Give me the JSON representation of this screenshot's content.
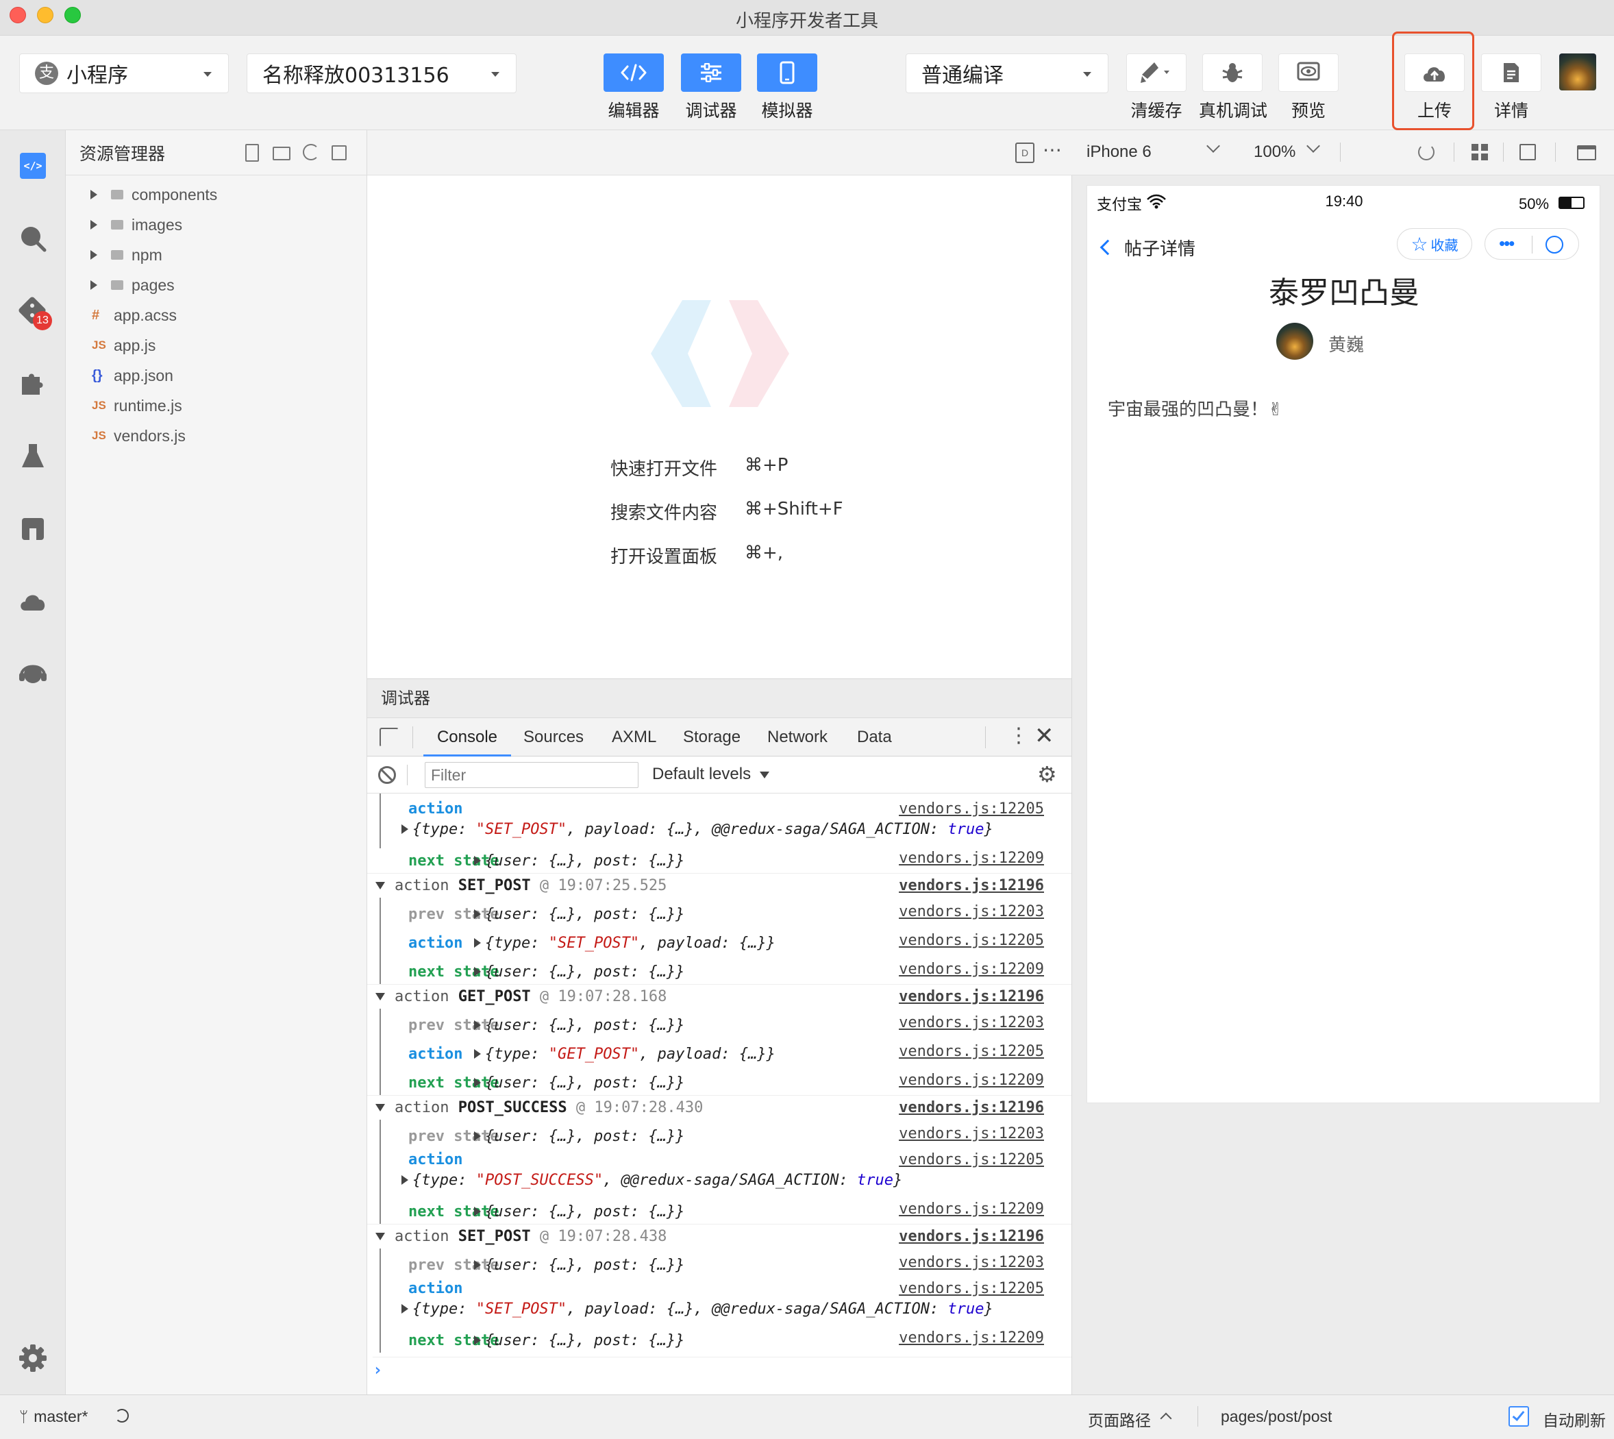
{
  "window": {
    "title": "小程序开发者工具"
  },
  "toolbar": {
    "app_type": "小程序",
    "project_name": "名称释放00313156",
    "compile_mode": "普通编译",
    "mode_buttons": [
      {
        "label": "编辑器",
        "icon": "code-icon"
      },
      {
        "label": "调试器",
        "icon": "sliders-icon"
      },
      {
        "label": "模拟器",
        "icon": "phone-icon"
      }
    ],
    "actions": [
      {
        "label": "清缓存",
        "icon": "broom-icon"
      },
      {
        "label": "真机调试",
        "icon": "bug-icon"
      },
      {
        "label": "预览",
        "icon": "eye-icon"
      },
      {
        "label": "上传",
        "icon": "cloud-upload-icon"
      },
      {
        "label": "详情",
        "icon": "document-icon"
      }
    ],
    "highlight_color": "#e8512d",
    "accent_color": "#3e8dff"
  },
  "activity_bar": {
    "git_badge": "13"
  },
  "explorer": {
    "title": "资源管理器",
    "items": [
      {
        "type": "folder",
        "name": "components"
      },
      {
        "type": "folder",
        "name": "images"
      },
      {
        "type": "folder",
        "name": "npm"
      },
      {
        "type": "folder",
        "name": "pages"
      },
      {
        "type": "acss",
        "prefix": "#",
        "name": "app.acss"
      },
      {
        "type": "js",
        "prefix": "JS",
        "name": "app.js"
      },
      {
        "type": "json",
        "prefix": "{}",
        "name": "app.json"
      },
      {
        "type": "js",
        "prefix": "JS",
        "name": "runtime.js"
      },
      {
        "type": "js",
        "prefix": "JS",
        "name": "vendors.js"
      }
    ]
  },
  "editor": {
    "shortcuts": [
      {
        "label": "快速打开文件",
        "keys": "⌘+P"
      },
      {
        "label": "搜索文件内容",
        "keys": "⌘+Shift+F"
      },
      {
        "label": "打开设置面板",
        "keys": "⌘+,"
      }
    ]
  },
  "debugger": {
    "title": "调试器",
    "tabs": [
      "Console",
      "Sources",
      "AXML",
      "Storage",
      "Network",
      "Data"
    ],
    "active_tab": "Console",
    "filter_placeholder": "Filter",
    "levels": "Default levels",
    "console": {
      "rows": [
        {
          "kind": "sub",
          "label": "action",
          "cls": "kw-blue",
          "link": "vendors.js:12205"
        },
        {
          "kind": "cont",
          "text_parts": [
            "{type: ",
            "\"SET_POST\"",
            ", payload: {…}, @@redux-saga/SAGA_ACTION: ",
            "true",
            "}"
          ]
        },
        {
          "kind": "sub",
          "label": "next state",
          "cls": "kw-green",
          "value": "{user: {…}, post: {…}}",
          "link": "vendors.js:12209"
        },
        {
          "kind": "group",
          "action": "SET_POST",
          "time": "@ 19:07:25.525",
          "link": "vendors.js:12196"
        },
        {
          "kind": "sub",
          "label": "prev state",
          "cls": "kw-gray",
          "value": "{user: {…}, post: {…}}",
          "link": "vendors.js:12203"
        },
        {
          "kind": "sub",
          "label": "action",
          "cls": "kw-blue",
          "value_parts": [
            "{type: ",
            "\"SET_POST\"",
            ", payload: {…}}"
          ],
          "link": "vendors.js:12205"
        },
        {
          "kind": "sub",
          "label": "next state",
          "cls": "kw-green",
          "value": "{user: {…}, post: {…}}",
          "link": "vendors.js:12209"
        },
        {
          "kind": "group",
          "action": "GET_POST",
          "time": "@ 19:07:28.168",
          "link": "vendors.js:12196"
        },
        {
          "kind": "sub",
          "label": "prev state",
          "cls": "kw-gray",
          "value": "{user: {…}, post: {…}}",
          "link": "vendors.js:12203"
        },
        {
          "kind": "sub",
          "label": "action",
          "cls": "kw-blue",
          "value_parts": [
            "{type: ",
            "\"GET_POST\"",
            ", payload: {…}}"
          ],
          "link": "vendors.js:12205"
        },
        {
          "kind": "sub",
          "label": "next state",
          "cls": "kw-green",
          "value": "{user: {…}, post: {…}}",
          "link": "vendors.js:12209"
        },
        {
          "kind": "group",
          "action": "POST_SUCCESS",
          "time": "@ 19:07:28.430",
          "link": "vendors.js:12196"
        },
        {
          "kind": "sub",
          "label": "prev state",
          "cls": "kw-gray",
          "value": "{user: {…}, post: {…}}",
          "link": "vendors.js:12203"
        },
        {
          "kind": "sub",
          "label": "action",
          "cls": "kw-blue",
          "link": "vendors.js:12205"
        },
        {
          "kind": "cont",
          "text_parts": [
            "{type: ",
            "\"POST_SUCCESS\"",
            ", @@redux-saga/SAGA_ACTION: ",
            "true",
            "}"
          ]
        },
        {
          "kind": "sub",
          "label": "next state",
          "cls": "kw-green",
          "value": "{user: {…}, post: {…}}",
          "link": "vendors.js:12209"
        },
        {
          "kind": "group",
          "action": "SET_POST",
          "time": "@ 19:07:28.438",
          "link": "vendors.js:12196"
        },
        {
          "kind": "sub",
          "label": "prev state",
          "cls": "kw-gray",
          "value": "{user: {…}, post: {…}}",
          "link": "vendors.js:12203"
        },
        {
          "kind": "sub",
          "label": "action",
          "cls": "kw-blue",
          "link": "vendors.js:12205"
        },
        {
          "kind": "cont",
          "text_parts": [
            "{type: ",
            "\"SET_POST\"",
            ", payload: {…}, @@redux-saga/SAGA_ACTION: ",
            "true",
            "}"
          ]
        },
        {
          "kind": "sub",
          "label": "next state",
          "cls": "kw-green",
          "value": "{user: {…}, post: {…}}",
          "link": "vendors.js:12209"
        }
      ],
      "prompt": "›"
    }
  },
  "simulator": {
    "device": "iPhone 6",
    "zoom": "100%",
    "phone": {
      "carrier": "支付宝",
      "time": "19:40",
      "battery": "50%",
      "battery_level": 0.5,
      "nav_title": "帖子详情",
      "favorite": "收藏",
      "post_title": "泰罗凹凸曼",
      "author": "黄巍",
      "content": "宇宙最强的凹凸曼！✌"
    }
  },
  "status_bar": {
    "branch": "master*",
    "page_path_label": "页面路径",
    "page_path": "pages/post/post",
    "auto_refresh": "自动刷新"
  }
}
